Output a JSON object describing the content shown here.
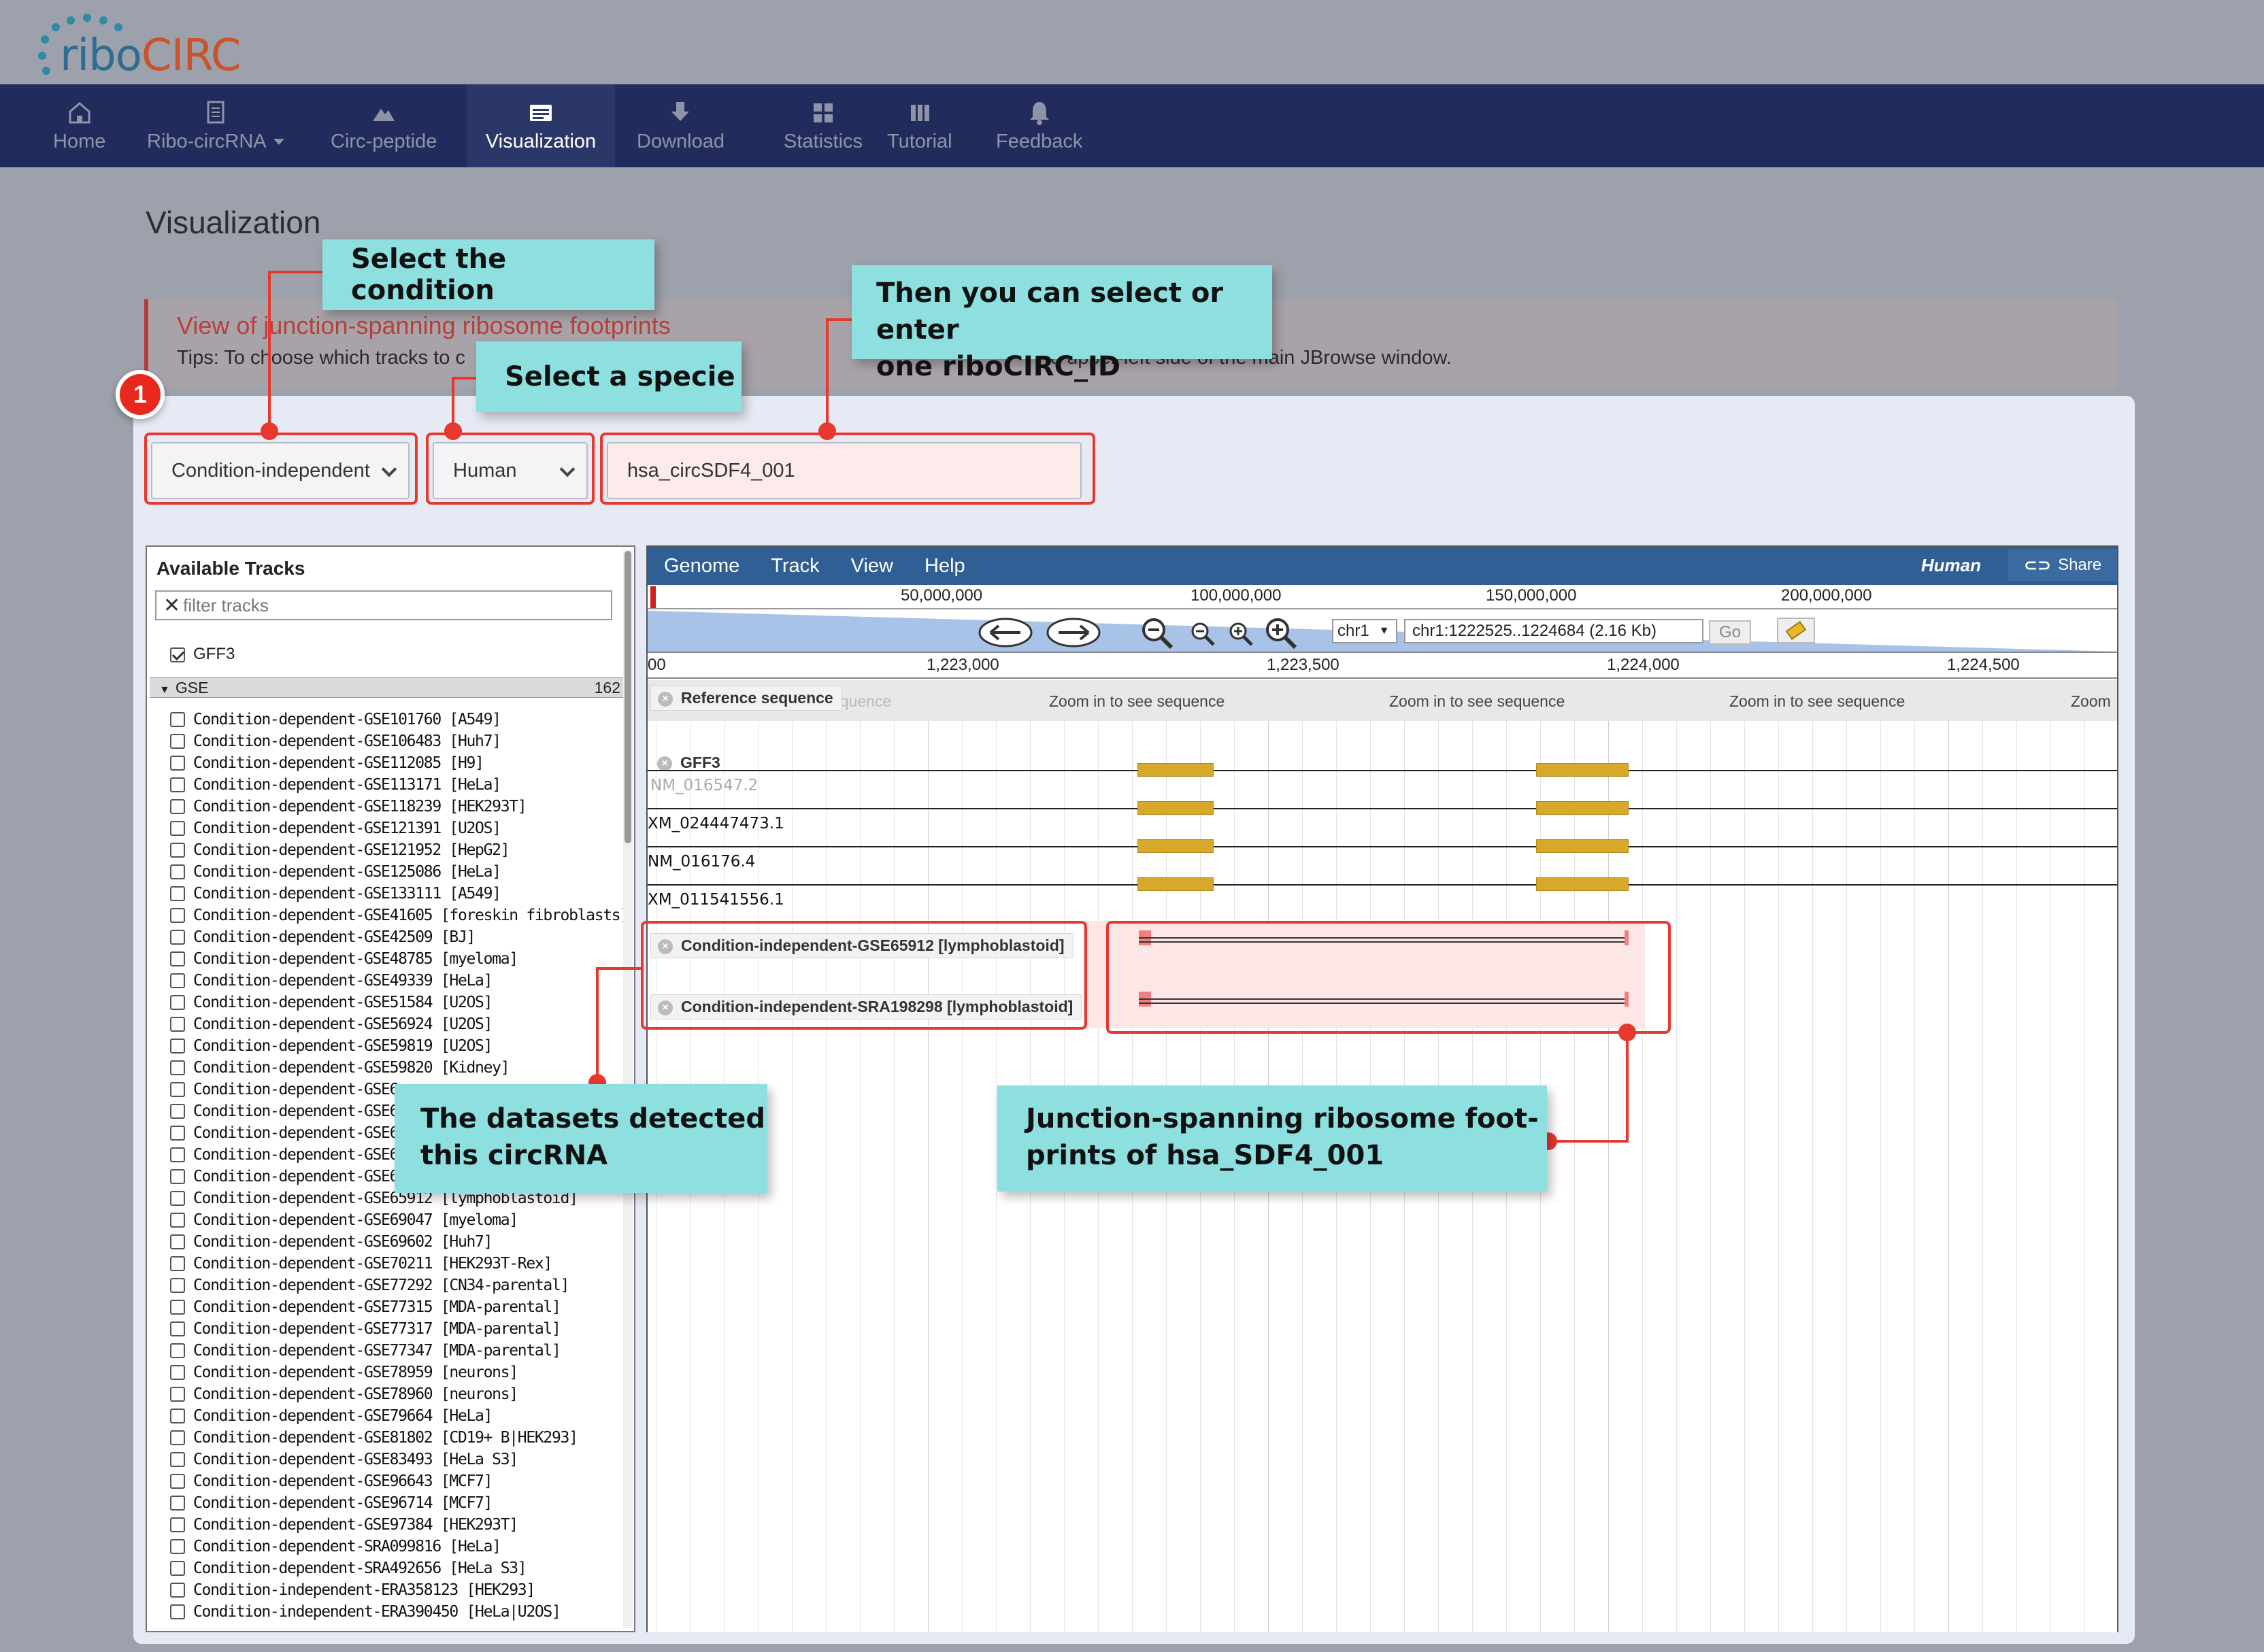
{
  "app": {
    "logo_text_left": "ribo",
    "logo_text_right": "CIRC",
    "brand_colors": {
      "blue": "#2e6d8f",
      "orange": "#c9542a",
      "nav": "#222c5c"
    }
  },
  "nav": {
    "items": [
      {
        "label": "Home",
        "icon": "home-icon"
      },
      {
        "label": "Ribo-circRNA",
        "icon": "document-icon"
      },
      {
        "label": "Circ-peptide",
        "icon": "mountain-icon"
      },
      {
        "label": "Visualization",
        "icon": "browser-icon",
        "active": true
      },
      {
        "label": "Download",
        "icon": "download-icon"
      },
      {
        "label": "Statistics",
        "icon": "grid-icon"
      },
      {
        "label": "Tutorial",
        "icon": "bars-icon"
      },
      {
        "label": "Feedback",
        "icon": "bell-icon"
      }
    ]
  },
  "page": {
    "title": "Visualization",
    "tip_title": "View of junction-spanning ribosome footprints",
    "tip_text": "Tips: To choose which tracks to c",
    "tip_text_tail": "e upper-left side of the main JBrowse window."
  },
  "controls": {
    "condition": "Condition-independent",
    "species": "Human",
    "circ_id": "hsa_circSDF4_001"
  },
  "tracklist": {
    "title": "Available Tracks",
    "filter_placeholder": "filter tracks",
    "gff3_label": "GFF3",
    "gse_group": "GSE",
    "gse_count": "162",
    "items": [
      "Condition-dependent-GSE101760 [A549]",
      "Condition-dependent-GSE106483 [Huh7]",
      "Condition-dependent-GSE112085 [H9]",
      "Condition-dependent-GSE113171 [HeLa]",
      "Condition-dependent-GSE118239 [HEK293T]",
      "Condition-dependent-GSE121391 [U2OS]",
      "Condition-dependent-GSE121952 [HepG2]",
      "Condition-dependent-GSE125086 [HeLa]",
      "Condition-dependent-GSE133111 [A549]",
      "Condition-dependent-GSE41605 [foreskin fibroblasts]",
      "Condition-dependent-GSE42509 [BJ]",
      "Condition-dependent-GSE48785 [myeloma]",
      "Condition-dependent-GSE49339 [HeLa]",
      "Condition-dependent-GSE51584 [U2OS]",
      "Condition-dependent-GSE56924 [U2OS]",
      "Condition-dependent-GSE59819 [U2OS]",
      "Condition-dependent-GSE59820 [Kidney]",
      "Condition-dependent-GSE6",
      "Condition-dependent-GSE6",
      "Condition-dependent-GSE6",
      "Condition-dependent-GSE6",
      "Condition-dependent-GSE6",
      "Condition-dependent-GSE65912 [lymphoblastoid]",
      "Condition-dependent-GSE69047 [myeloma]",
      "Condition-dependent-GSE69602 [Huh7]",
      "Condition-dependent-GSE70211 [HEK293T-Rex]",
      "Condition-dependent-GSE77292 [CN34-parental]",
      "Condition-dependent-GSE77315 [MDA-parental]",
      "Condition-dependent-GSE77317 [MDA-parental]",
      "Condition-dependent-GSE77347 [MDA-parental]",
      "Condition-dependent-GSE78959 [neurons]",
      "Condition-dependent-GSE78960 [neurons]",
      "Condition-dependent-GSE79664 [HeLa]",
      "Condition-dependent-GSE81802 [CD19+ B|HEK293]",
      "Condition-dependent-GSE83493 [HeLa S3]",
      "Condition-dependent-GSE96643 [MCF7]",
      "Condition-dependent-GSE96714 [MCF7]",
      "Condition-dependent-GSE97384 [HEK293T]",
      "Condition-dependent-SRA099816 [HeLa]",
      "Condition-dependent-SRA492656 [HeLa S3]",
      "Condition-independent-ERA358123 [HEK293]",
      "Condition-independent-ERA390450 [HeLa|U2OS]"
    ]
  },
  "jbrowse": {
    "menus": [
      "Genome",
      "Track",
      "View",
      "Help"
    ],
    "species": "Human",
    "share": "Share",
    "overview_ticks": [
      "50,000,000",
      "100,000,000",
      "150,000,000",
      "200,000,000"
    ],
    "chrom": "chr1",
    "location": "chr1:1222525..1224684 (2.16 Kb)",
    "go": "Go",
    "scale_ticks": [
      "00",
      "1,223,000",
      "1,223,500",
      "1,224,000",
      "1,224,500"
    ],
    "ref_label": "Reference sequence",
    "ref_label_ghost": "equence",
    "zoom_texts": [
      "Zoom in to see sequence",
      "Zoom in to see sequence",
      "Zoom in to see sequence",
      "Zoom"
    ],
    "gff3_track": "GFF3",
    "features": [
      "NM_016547.2",
      "XM_024447473.1",
      "NM_016176.4",
      "XM_011541556.1"
    ],
    "fp_tracks": [
      "Condition-independent-GSE65912 [lymphoblastoid]",
      "Condition-independent-SRA198298 [lymphoblastoid]"
    ]
  },
  "annotations": {
    "badge": "1",
    "condition": "Select the condition",
    "specie": "Select a specie",
    "id_line1": "Then you can select or enter",
    "id_line2": "one riboCIRC_ID",
    "datasets_line1": "The datasets detected",
    "datasets_line2": "this circRNA",
    "junction_line1": "Junction-spanning ribosome foot-",
    "junction_line2": "prints of hsa_SDF4_001"
  }
}
